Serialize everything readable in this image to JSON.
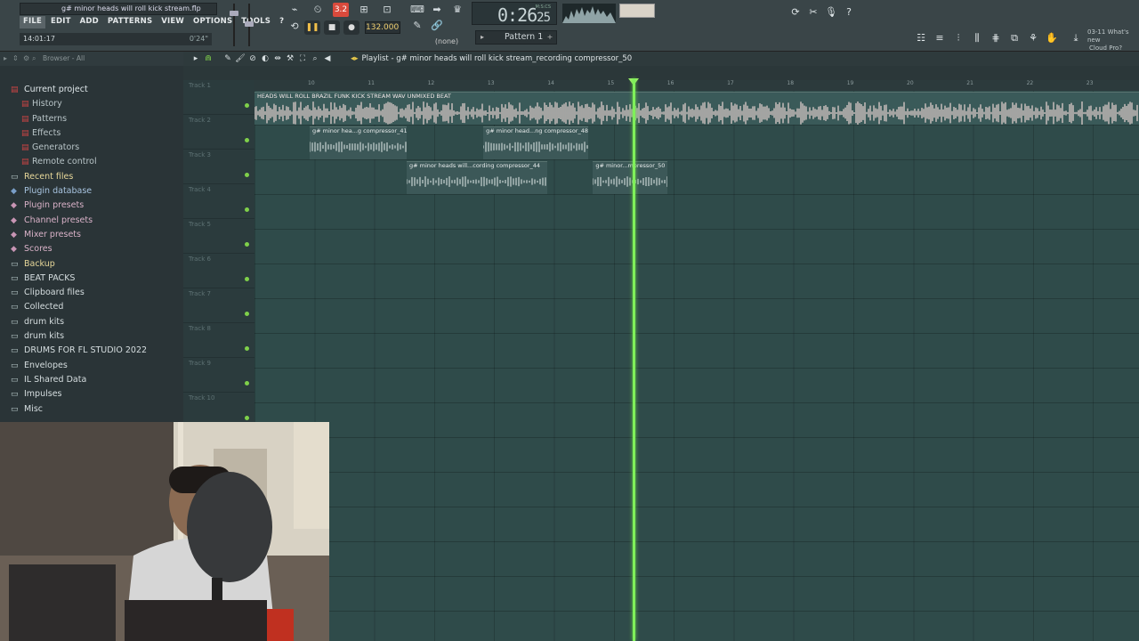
{
  "window": {
    "title": "g# minor heads will roll kick stream.flp"
  },
  "menu": [
    "FILE",
    "EDIT",
    "ADD",
    "PATTERNS",
    "VIEW",
    "OPTIONS",
    "TOOLS",
    "?"
  ],
  "hint": {
    "left": "14:01:17",
    "right": "0'24\""
  },
  "transport": {
    "time": "0:26",
    "time_frac": "25",
    "time_unit": "M:S:CS",
    "tempo": "132.000",
    "snap": "(none)",
    "pattern": "Pattern 1",
    "rec_label": "3.2"
  },
  "news": {
    "date": "03-11",
    "text1": "What's new",
    "text2": "Cloud Pro?"
  },
  "browser": {
    "header": "Browser - All",
    "items": [
      {
        "label": "Current project",
        "type": "cur",
        "icon": "project-icon"
      },
      {
        "label": "History",
        "type": "sub",
        "icon": "history-icon"
      },
      {
        "label": "Patterns",
        "type": "sub",
        "icon": "patterns-icon"
      },
      {
        "label": "Effects",
        "type": "sub",
        "icon": "effects-icon"
      },
      {
        "label": "Generators",
        "type": "sub",
        "icon": "generators-icon"
      },
      {
        "label": "Remote control",
        "type": "sub",
        "icon": "remote-icon"
      },
      {
        "label": "Recent files",
        "type": "yellow",
        "icon": "folder-icon"
      },
      {
        "label": "Plugin database",
        "type": "blue",
        "icon": "plugin-db-icon"
      },
      {
        "label": "Plugin presets",
        "type": "pink",
        "icon": "plugin-presets-icon"
      },
      {
        "label": "Channel presets",
        "type": "pink",
        "icon": "channel-presets-icon"
      },
      {
        "label": "Mixer presets",
        "type": "pink",
        "icon": "mixer-presets-icon"
      },
      {
        "label": "Scores",
        "type": "pink",
        "icon": "scores-icon"
      },
      {
        "label": "Backup",
        "type": "yellow",
        "icon": "folder-icon"
      },
      {
        "label": "BEAT PACKS",
        "type": "white",
        "icon": "folder-icon"
      },
      {
        "label": "Clipboard files",
        "type": "white",
        "icon": "folder-icon"
      },
      {
        "label": "Collected",
        "type": "white",
        "icon": "folder-icon"
      },
      {
        "label": "drum kits",
        "type": "white",
        "icon": "folder-icon"
      },
      {
        "label": "drum kits",
        "type": "white",
        "icon": "folder-icon"
      },
      {
        "label": "DRUMS FOR FL STUDIO 2022",
        "type": "white",
        "icon": "folder-icon"
      },
      {
        "label": "Envelopes",
        "type": "white",
        "icon": "folder-icon"
      },
      {
        "label": "IL Shared Data",
        "type": "white",
        "icon": "folder-icon"
      },
      {
        "label": "Impulses",
        "type": "white",
        "icon": "folder-icon"
      },
      {
        "label": "Misc",
        "type": "white",
        "icon": "folder-icon"
      }
    ]
  },
  "playlist": {
    "title": "Playlist - g# minor heads will roll kick stream_recording compressor_50",
    "ruler": [
      "10",
      "11",
      "12",
      "13",
      "14",
      "15",
      "16",
      "17",
      "18",
      "19",
      "20",
      "21",
      "22",
      "23"
    ],
    "tracks": [
      "Track 1",
      "Track 2",
      "Track 3",
      "Track 4",
      "Track 5",
      "Track 6",
      "Track 7",
      "Track 8",
      "Track 9",
      "Track 10"
    ],
    "clips": [
      {
        "label": "HEADS WILL ROLL BRAZIL FUNK KICK STREAM WAV UNMIXED BEAT",
        "track": 0,
        "start": 10.0,
        "end": 24.0,
        "big": true
      },
      {
        "label": "g# minor hea...g compressor_41",
        "track": 1,
        "start": 10.0,
        "end": 11.62
      },
      {
        "label": "g# minor head...ng compressor_48",
        "track": 1,
        "start": 12.9,
        "end": 14.65
      },
      {
        "label": "g# minor heads will...cording compressor_44",
        "track": 2,
        "start": 11.62,
        "end": 13.97
      },
      {
        "label": "g# minor...mpressor_50",
        "track": 2,
        "start": 14.73,
        "end": 15.98
      }
    ],
    "playhead_bar": 15.39
  },
  "colors": {
    "accent": "#7ff05a",
    "grid": "#2f4b4a",
    "record": "#d94a3c",
    "tempo": "#f0d070"
  }
}
